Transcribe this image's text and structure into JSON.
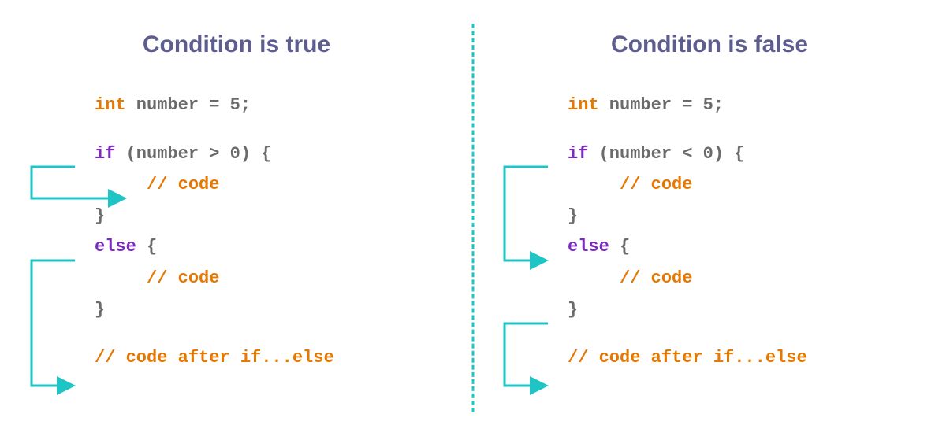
{
  "left": {
    "heading": "Condition is true",
    "code": {
      "line1_kw": "int",
      "line1_rest": " number = 5;",
      "line2_kw": "if",
      "line2_rest": " (number > 0) {",
      "line3_comment": "     // code",
      "line4": "}",
      "line5_kw": "else",
      "line5_rest": " {",
      "line6_comment": "     // code",
      "line7": "}",
      "line8_comment": "// code after if...else"
    }
  },
  "right": {
    "heading": "Condition is false",
    "code": {
      "line1_kw": "int",
      "line1_rest": " number = 5;",
      "line2_kw": "if",
      "line2_rest": " (number < 0) {",
      "line3_comment": "     // code",
      "line4": "}",
      "line5_kw": "else",
      "line5_rest": " {",
      "line6_comment": "     // code",
      "line7": "}",
      "line8_comment": "// code after if...else"
    }
  }
}
